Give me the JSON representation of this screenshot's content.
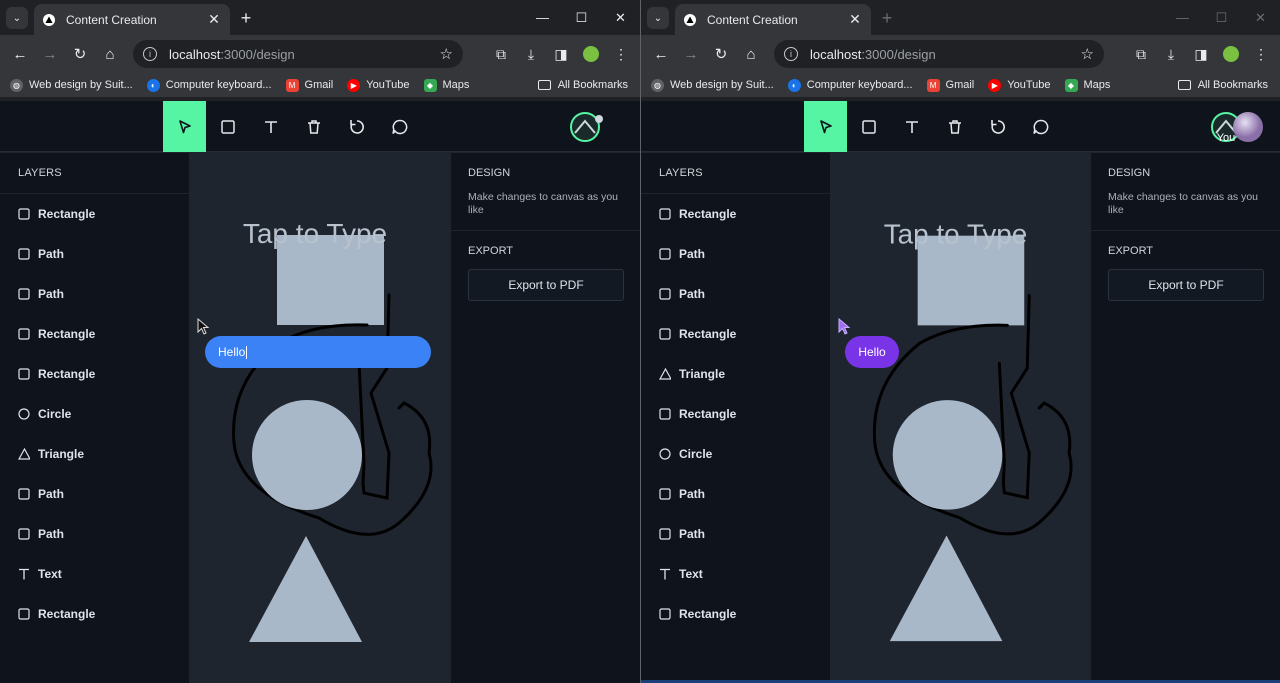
{
  "browser": {
    "tab_title": "Content Creation",
    "url_host": "localhost",
    "url_path": ":3000/design",
    "bookmarks": [
      {
        "label": "Web design by Suit...",
        "icon": "globe-icon",
        "color": "#5f6368"
      },
      {
        "label": "Computer keyboard...",
        "icon": "keyboard-site-icon",
        "color": "#1a73e8"
      },
      {
        "label": "Gmail",
        "icon": "gmail-icon",
        "color": "#ea4335"
      },
      {
        "label": "YouTube",
        "icon": "youtube-icon",
        "color": "#ff0000"
      },
      {
        "label": "Maps",
        "icon": "maps-icon",
        "color": "#34a853"
      }
    ],
    "all_bookmarks": "All Bookmarks"
  },
  "app": {
    "accent": "#55f5a4",
    "tools": [
      "select-tool",
      "rectangle-tool",
      "text-tool",
      "delete-tool",
      "reset-tool",
      "comment-tool"
    ],
    "layers_title": "LAYERS",
    "design_title": "DESIGN",
    "design_desc": "Make changes to canvas as you like",
    "export_title": "EXPORT",
    "export_button": "Export to PDF",
    "canvas_text": "Tap to Type"
  },
  "left_window": {
    "layers": [
      {
        "label": "Rectangle",
        "icon": "square-icon"
      },
      {
        "label": "Path",
        "icon": "square-icon"
      },
      {
        "label": "Path",
        "icon": "square-icon"
      },
      {
        "label": "Rectangle",
        "icon": "square-icon"
      },
      {
        "label": "Rectangle",
        "icon": "square-icon"
      },
      {
        "label": "Circle",
        "icon": "circle-icon"
      },
      {
        "label": "Triangle",
        "icon": "triangle-icon"
      },
      {
        "label": "Path",
        "icon": "square-icon"
      },
      {
        "label": "Path",
        "icon": "square-icon"
      },
      {
        "label": "Text",
        "icon": "text-icon"
      },
      {
        "label": "Rectangle",
        "icon": "square-icon"
      }
    ],
    "chat_input_value": "Hello"
  },
  "right_window": {
    "layers": [
      {
        "label": "Rectangle",
        "icon": "square-icon"
      },
      {
        "label": "Path",
        "icon": "square-icon"
      },
      {
        "label": "Path",
        "icon": "square-icon"
      },
      {
        "label": "Rectangle",
        "icon": "square-icon"
      },
      {
        "label": "Triangle",
        "icon": "triangle-icon"
      },
      {
        "label": "Rectangle",
        "icon": "square-icon"
      },
      {
        "label": "Circle",
        "icon": "circle-icon"
      },
      {
        "label": "Path",
        "icon": "square-icon"
      },
      {
        "label": "Path",
        "icon": "square-icon"
      },
      {
        "label": "Text",
        "icon": "text-icon"
      },
      {
        "label": "Rectangle",
        "icon": "square-icon"
      }
    ],
    "chat_bubble": "Hello",
    "avatar_label": "You"
  }
}
